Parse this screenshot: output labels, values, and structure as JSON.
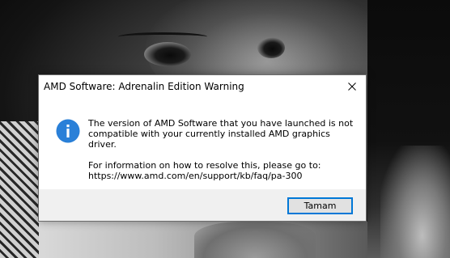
{
  "dialog": {
    "title": "AMD Software: Adrenalin Edition Warning",
    "icon": "info-icon",
    "message_line1": "The version of AMD Software that you have launched is not",
    "message_line2": "compatible with your currently installed AMD graphics driver.",
    "message_line3": "For information on how to resolve this, please go to:",
    "message_line4": "https://www.amd.com/en/support/kb/faq/pa-300",
    "ok_label": "Tamam",
    "close_icon": "close-icon"
  },
  "colors": {
    "accent": "#0078d7",
    "info_icon": "#1e78d4",
    "footer_bg": "#f0f0f0",
    "button_bg": "#e1e1e1"
  }
}
